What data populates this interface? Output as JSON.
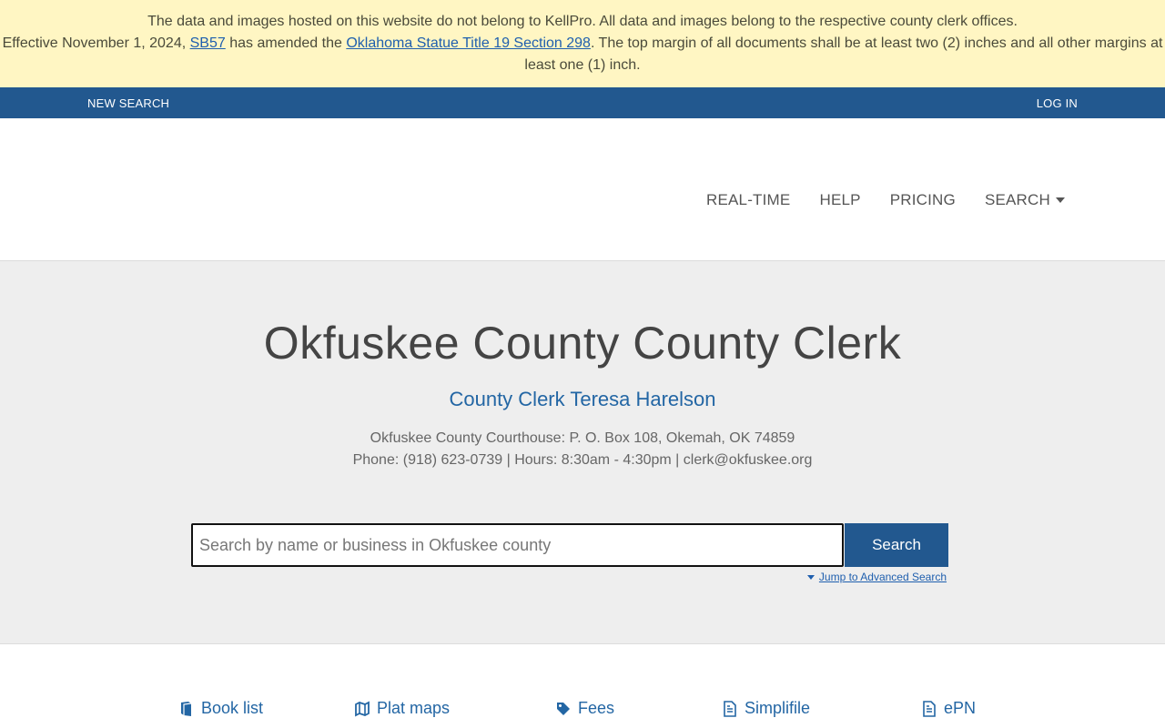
{
  "notice": {
    "line1": "The data and images hosted on this website do not belong to KellPro. All data and images belong to the respective county clerk offices.",
    "line2_pre": "Effective November 1, 2024,",
    "link1": "SB57",
    "line2_mid": "has amended the",
    "link2": "Oklahoma Statue Title 19 Section 298",
    "line2_post": ". The top margin of all documents shall be at least two (2) inches and all other margins at least one (1) inch.",
    "bg_color": "#fff6c3"
  },
  "topbar": {
    "new_search": "NEW SEARCH",
    "login": "LOG IN",
    "bg_color": "#22588f"
  },
  "nav": {
    "items": [
      "REAL-TIME",
      "HELP",
      "PRICING",
      "SEARCH"
    ],
    "dropdown_icon": "caret-down-icon"
  },
  "hero": {
    "title": "Okfuskee County County Clerk",
    "subtitle": "County Clerk Teresa Harelson",
    "address": "Okfuskee County Courthouse: P. O. Box 108, Okemah, OK 74859",
    "contact": "Phone: (918) 623-0739 | Hours: 8:30am - 4:30pm | clerk@okfuskee.org",
    "accent_color": "#2366a4"
  },
  "search": {
    "placeholder": "Search by name or business in Okfuskee county",
    "value": "",
    "button": "Search",
    "advanced_link": "Jump to Advanced Search"
  },
  "links": [
    {
      "label": "Book list",
      "icon": "book-icon"
    },
    {
      "label": "Plat maps",
      "icon": "map-icon"
    },
    {
      "label": "Fees",
      "icon": "tag-icon"
    },
    {
      "label": "Simplifile",
      "icon": "document-icon"
    },
    {
      "label": "ePN",
      "icon": "document-icon"
    }
  ]
}
